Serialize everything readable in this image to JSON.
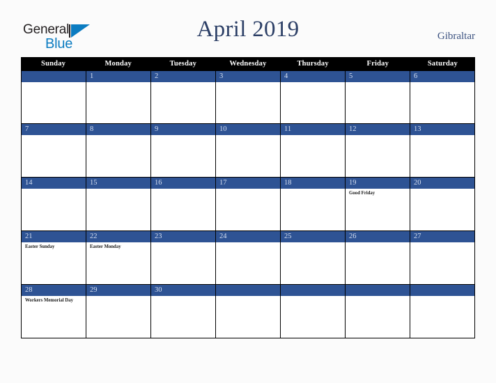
{
  "brand": {
    "name_top": "General",
    "name_bottom": "Blue",
    "color_dark": "#231f20",
    "color_blue": "#0b7cc1"
  },
  "header": {
    "title": "April 2019",
    "country": "Gibraltar",
    "title_color": "#2c3f66"
  },
  "calendar": {
    "accent_color": "#2e5394",
    "header_bg": "#000000",
    "weekdays": [
      "Sunday",
      "Monday",
      "Tuesday",
      "Wednesday",
      "Thursday",
      "Friday",
      "Saturday"
    ],
    "weeks": [
      [
        {
          "num": "",
          "event": ""
        },
        {
          "num": "1",
          "event": ""
        },
        {
          "num": "2",
          "event": ""
        },
        {
          "num": "3",
          "event": ""
        },
        {
          "num": "4",
          "event": ""
        },
        {
          "num": "5",
          "event": ""
        },
        {
          "num": "6",
          "event": ""
        }
      ],
      [
        {
          "num": "7",
          "event": ""
        },
        {
          "num": "8",
          "event": ""
        },
        {
          "num": "9",
          "event": ""
        },
        {
          "num": "10",
          "event": ""
        },
        {
          "num": "11",
          "event": ""
        },
        {
          "num": "12",
          "event": ""
        },
        {
          "num": "13",
          "event": ""
        }
      ],
      [
        {
          "num": "14",
          "event": ""
        },
        {
          "num": "15",
          "event": ""
        },
        {
          "num": "16",
          "event": ""
        },
        {
          "num": "17",
          "event": ""
        },
        {
          "num": "18",
          "event": ""
        },
        {
          "num": "19",
          "event": "Good Friday"
        },
        {
          "num": "20",
          "event": ""
        }
      ],
      [
        {
          "num": "21",
          "event": "Easter Sunday"
        },
        {
          "num": "22",
          "event": "Easter Monday"
        },
        {
          "num": "23",
          "event": ""
        },
        {
          "num": "24",
          "event": ""
        },
        {
          "num": "25",
          "event": ""
        },
        {
          "num": "26",
          "event": ""
        },
        {
          "num": "27",
          "event": ""
        }
      ],
      [
        {
          "num": "28",
          "event": "Workers Memorial Day"
        },
        {
          "num": "29",
          "event": ""
        },
        {
          "num": "30",
          "event": ""
        },
        {
          "num": "",
          "event": ""
        },
        {
          "num": "",
          "event": ""
        },
        {
          "num": "",
          "event": ""
        },
        {
          "num": "",
          "event": ""
        }
      ]
    ]
  }
}
